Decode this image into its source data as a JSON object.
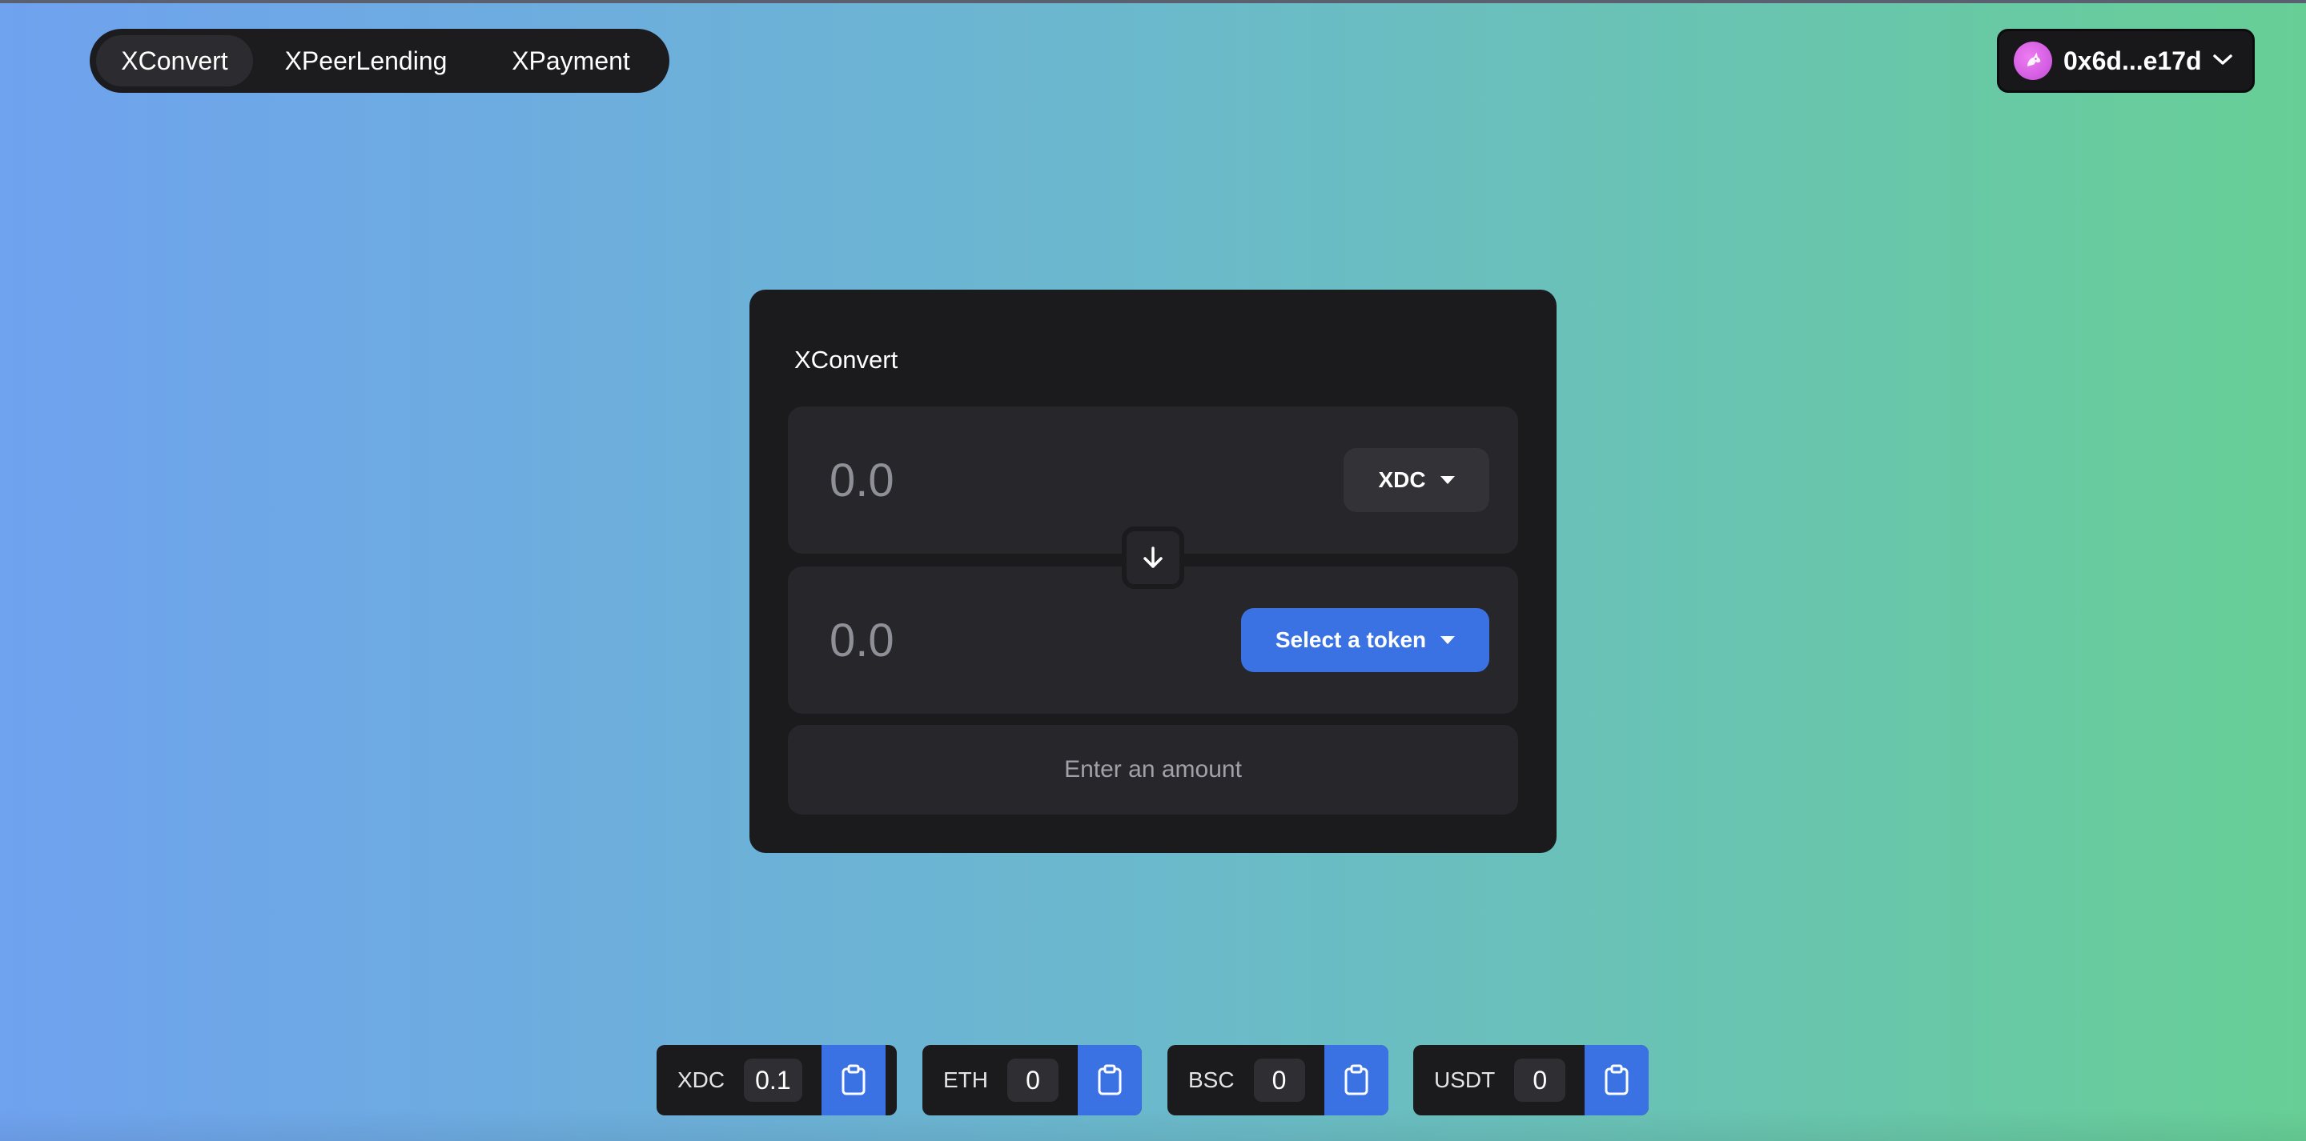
{
  "nav": {
    "items": [
      {
        "label": "XConvert",
        "active": true
      },
      {
        "label": "XPeerLending",
        "active": false
      },
      {
        "label": "XPayment",
        "active": false
      }
    ]
  },
  "wallet": {
    "address": "0x6d...e17d",
    "avatar_icon": "unicorn-icon",
    "avatar_color": "#d65ce6"
  },
  "card": {
    "title": "XConvert",
    "from": {
      "placeholder": "0.0",
      "token_label": "XDC"
    },
    "to": {
      "placeholder": "0.0",
      "token_label": "Select a token"
    },
    "swap_icon": "arrow-down-icon",
    "action_label": "Enter an amount"
  },
  "balances": [
    {
      "symbol": "XDC",
      "value": "0.1"
    },
    {
      "symbol": "ETH",
      "value": "0"
    },
    {
      "symbol": "BSC",
      "value": "0"
    },
    {
      "symbol": "USDT",
      "value": "0"
    }
  ],
  "colors": {
    "accent": "#3a72e4",
    "card_bg": "#1b1b1e",
    "field_bg": "#27272b",
    "gradient_start": "#6fa2ef",
    "gradient_end": "#67cf96"
  }
}
